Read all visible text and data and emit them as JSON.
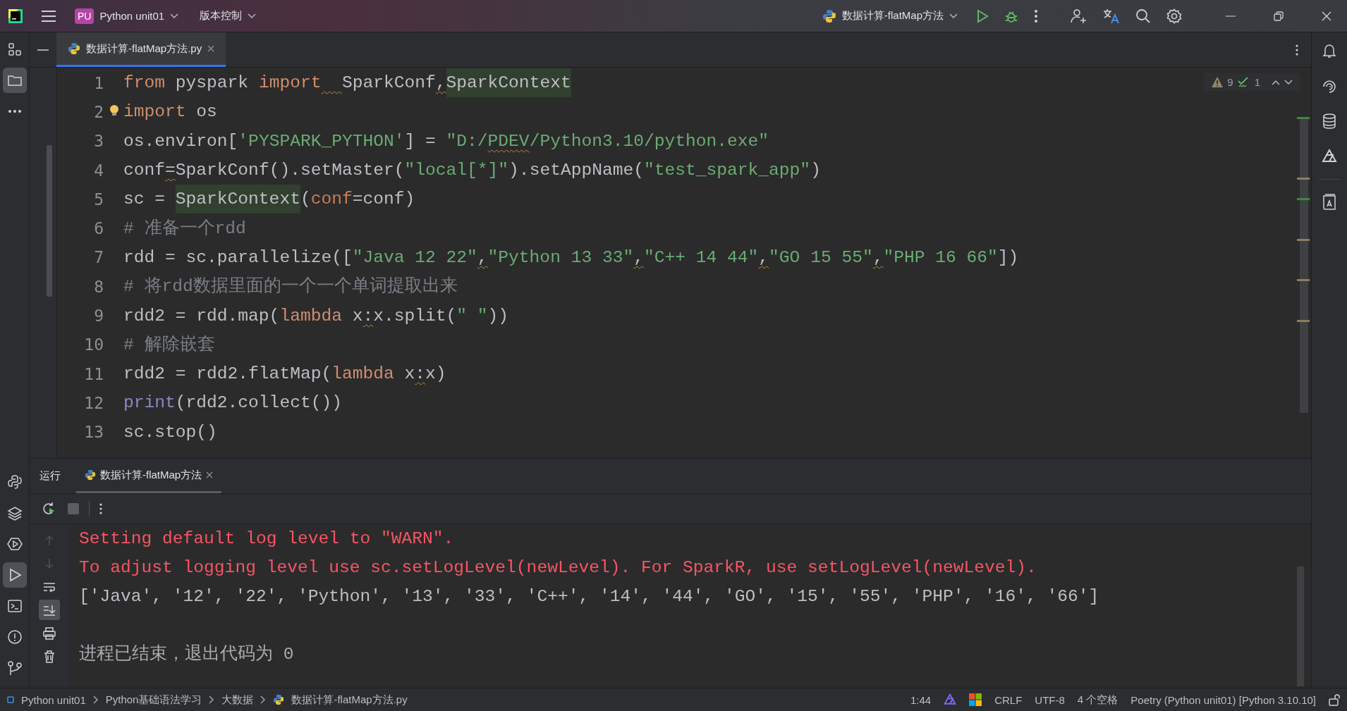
{
  "title_bar": {
    "project_badge": "PU",
    "project": "Python unit01",
    "vcs": "版本控制",
    "run_config": "数据计算-flatMap方法"
  },
  "left_toolbar": {
    "top": [
      {
        "selected": false
      },
      {
        "selected": true
      },
      {
        "selected": false
      }
    ],
    "bottom": [
      {
        "selected": false
      },
      {
        "selected": false
      },
      {
        "selected": false
      },
      {
        "selected": true
      },
      {
        "selected": false
      },
      {
        "selected": false
      },
      {
        "selected": false
      }
    ]
  },
  "editor_tabs": [
    {
      "label": "数据计算-flatMap方法.py",
      "selected": true
    }
  ],
  "inspections": {
    "warnings": "9",
    "typos": "1"
  },
  "code": {
    "lines": [
      {
        "number": "1",
        "tokens": [
          {
            "text": "from",
            "kind": "keyword"
          },
          {
            "text": " pyspark ",
            "kind": "plain"
          },
          {
            "text": "import",
            "kind": "keyword",
            "warning_after": true
          },
          {
            "text": "SparkConf",
            "kind": "plain"
          },
          {
            "text": ",",
            "kind": "plain",
            "warning": true
          },
          {
            "text": "SparkContext",
            "kind": "highlight"
          }
        ]
      },
      {
        "number": "2",
        "bulb": true,
        "tokens": [
          {
            "text": "import",
            "kind": "keyword"
          },
          {
            "text": " os",
            "kind": "plain"
          }
        ]
      },
      {
        "number": "3",
        "tokens": [
          {
            "text": "os.environ[",
            "kind": "plain"
          },
          {
            "text": "'PYSPARK_PYTHON'",
            "kind": "string"
          },
          {
            "text": "] = ",
            "kind": "plain"
          },
          {
            "text": "\"D:/",
            "kind": "string"
          },
          {
            "text": "PDEV",
            "kind": "string",
            "warning": true
          },
          {
            "text": "/Python3.10/python.exe\"",
            "kind": "string"
          }
        ]
      },
      {
        "number": "4",
        "tokens": [
          {
            "text": "conf",
            "kind": "plain"
          },
          {
            "text": "=",
            "kind": "plain",
            "warning": true
          },
          {
            "text": "SparkConf().setMaster(",
            "kind": "plain"
          },
          {
            "text": "\"local[*]\"",
            "kind": "string"
          },
          {
            "text": ").setAppName(",
            "kind": "plain"
          },
          {
            "text": "\"test_spark_app\"",
            "kind": "string"
          },
          {
            "text": ")",
            "kind": "plain"
          }
        ]
      },
      {
        "number": "5",
        "tokens": [
          {
            "text": "sc = ",
            "kind": "plain"
          },
          {
            "text": "SparkContext",
            "kind": "highlight"
          },
          {
            "text": "(",
            "kind": "plain"
          },
          {
            "text": "conf",
            "kind": "param"
          },
          {
            "text": "=conf)",
            "kind": "plain"
          }
        ]
      },
      {
        "number": "6",
        "tokens": [
          {
            "text": "# 准备一个rdd",
            "kind": "comment"
          }
        ]
      },
      {
        "number": "7",
        "tokens": [
          {
            "text": "rdd = sc.parallelize([",
            "kind": "plain"
          },
          {
            "text": "\"Java 12 22\"",
            "kind": "string"
          },
          {
            "text": ",",
            "kind": "plain",
            "warning": true
          },
          {
            "text": "\"Python 13 33\"",
            "kind": "string"
          },
          {
            "text": ",",
            "kind": "plain",
            "warning": true
          },
          {
            "text": "\"C++ 14 44\"",
            "kind": "string"
          },
          {
            "text": ",",
            "kind": "plain",
            "warning": true
          },
          {
            "text": "\"GO 15 55\"",
            "kind": "string"
          },
          {
            "text": ",",
            "kind": "plain",
            "warning": true
          },
          {
            "text": "\"PHP 16 66\"",
            "kind": "string"
          },
          {
            "text": "])",
            "kind": "plain"
          }
        ]
      },
      {
        "number": "8",
        "tokens": [
          {
            "text": "# 将rdd数据里面的一个一个单词提取出来",
            "kind": "comment"
          }
        ]
      },
      {
        "number": "9",
        "tokens": [
          {
            "text": "rdd2 = rdd.map(",
            "kind": "plain"
          },
          {
            "text": "lambda",
            "kind": "keyword"
          },
          {
            "text": " x",
            "kind": "plain"
          },
          {
            "text": ":",
            "kind": "plain",
            "warning": true
          },
          {
            "text": "x.split(",
            "kind": "plain"
          },
          {
            "text": "\" \"",
            "kind": "string"
          },
          {
            "text": "))",
            "kind": "plain"
          }
        ]
      },
      {
        "number": "10",
        "tokens": [
          {
            "text": "# 解除嵌套",
            "kind": "comment"
          }
        ]
      },
      {
        "number": "11",
        "tokens": [
          {
            "text": "rdd2 = rdd2.flatMap(",
            "kind": "plain"
          },
          {
            "text": "lambda",
            "kind": "keyword"
          },
          {
            "text": " x",
            "kind": "plain"
          },
          {
            "text": ":",
            "kind": "plain",
            "warning": true
          },
          {
            "text": "x)",
            "kind": "plain"
          }
        ]
      },
      {
        "number": "12",
        "tokens": [
          {
            "text": "print",
            "kind": "builtin"
          },
          {
            "text": "(rdd2.collect())",
            "kind": "plain"
          }
        ]
      },
      {
        "number": "13",
        "tokens": [
          {
            "text": "sc.stop()",
            "kind": "plain"
          }
        ]
      }
    ]
  },
  "run_panel": {
    "label": "运行",
    "tabs": [
      {
        "label": "数据计算-flatMap方法",
        "selected": true
      }
    ],
    "side_tools": [
      {
        "selected": false,
        "disabled": true
      },
      {
        "selected": false,
        "disabled": true
      },
      {
        "selected": false,
        "disabled": false
      },
      {
        "selected": true,
        "disabled": false
      },
      {
        "selected": false,
        "disabled": false
      },
      {
        "selected": false,
        "disabled": false
      }
    ],
    "console": [
      {
        "kind": "error",
        "text": "Setting default log level to \"WARN\"."
      },
      {
        "kind": "error",
        "text": "To adjust logging level use sc.setLogLevel(newLevel). For SparkR, use setLogLevel(newLevel)."
      },
      {
        "kind": "output",
        "text": "['Java', '12', '22', 'Python', '13', '33', 'C++', '14', '44', 'GO', '15', '55', 'PHP', '16', '66']"
      },
      {
        "kind": "blank"
      },
      {
        "kind": "info",
        "text": "进程已结束，退出代码为 0"
      }
    ]
  },
  "status_bar": {
    "breadcrumbs": [
      "Python unit01",
      "Python基础语法学习",
      "大数据",
      "数据计算-flatMap方法.py"
    ],
    "position": "1:44",
    "line_separator": "CRLF",
    "encoding": "UTF-8",
    "indent": "4 个空格",
    "interpreter": "Poetry (Python unit01) [Python 3.10.10]"
  }
}
